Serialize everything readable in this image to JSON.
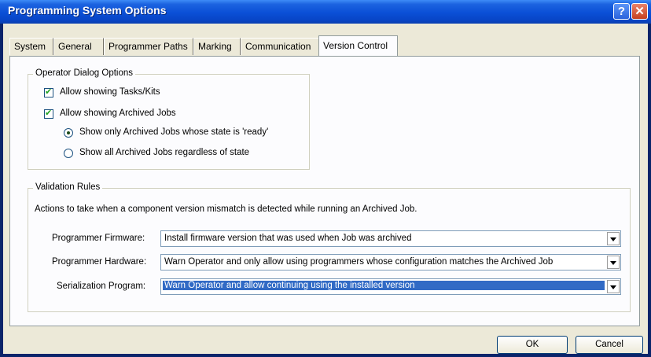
{
  "window": {
    "title": "Programming System Options",
    "help_glyph": "?",
    "close_glyph": "✕"
  },
  "tabs": [
    {
      "label": "System"
    },
    {
      "label": "General"
    },
    {
      "label": "Programmer Paths"
    },
    {
      "label": "Marking"
    },
    {
      "label": "Communication"
    },
    {
      "label": "Version Control"
    }
  ],
  "operator_group": {
    "title": "Operator Dialog Options",
    "allow_tasks": "Allow showing Tasks/Kits",
    "allow_archived": "Allow showing Archived Jobs",
    "radio_ready": "Show only Archived Jobs whose state is 'ready'",
    "radio_all": "Show all Archived Jobs regardless of state"
  },
  "validation_group": {
    "title": "Validation Rules",
    "description": "Actions to take when a component version mismatch is detected while running an Archived Job.",
    "firmware_label": "Programmer Firmware:",
    "firmware_value": "Install firmware version that was used when Job was archived",
    "hardware_label": "Programmer Hardware:",
    "hardware_value": "Warn Operator and only allow using programmers whose configuration matches the Archived Job",
    "serialization_label": "Serialization Program:",
    "serialization_value": "Warn Operator and allow continuing using the installed version"
  },
  "buttons": {
    "ok": "OK",
    "cancel": "Cancel"
  }
}
